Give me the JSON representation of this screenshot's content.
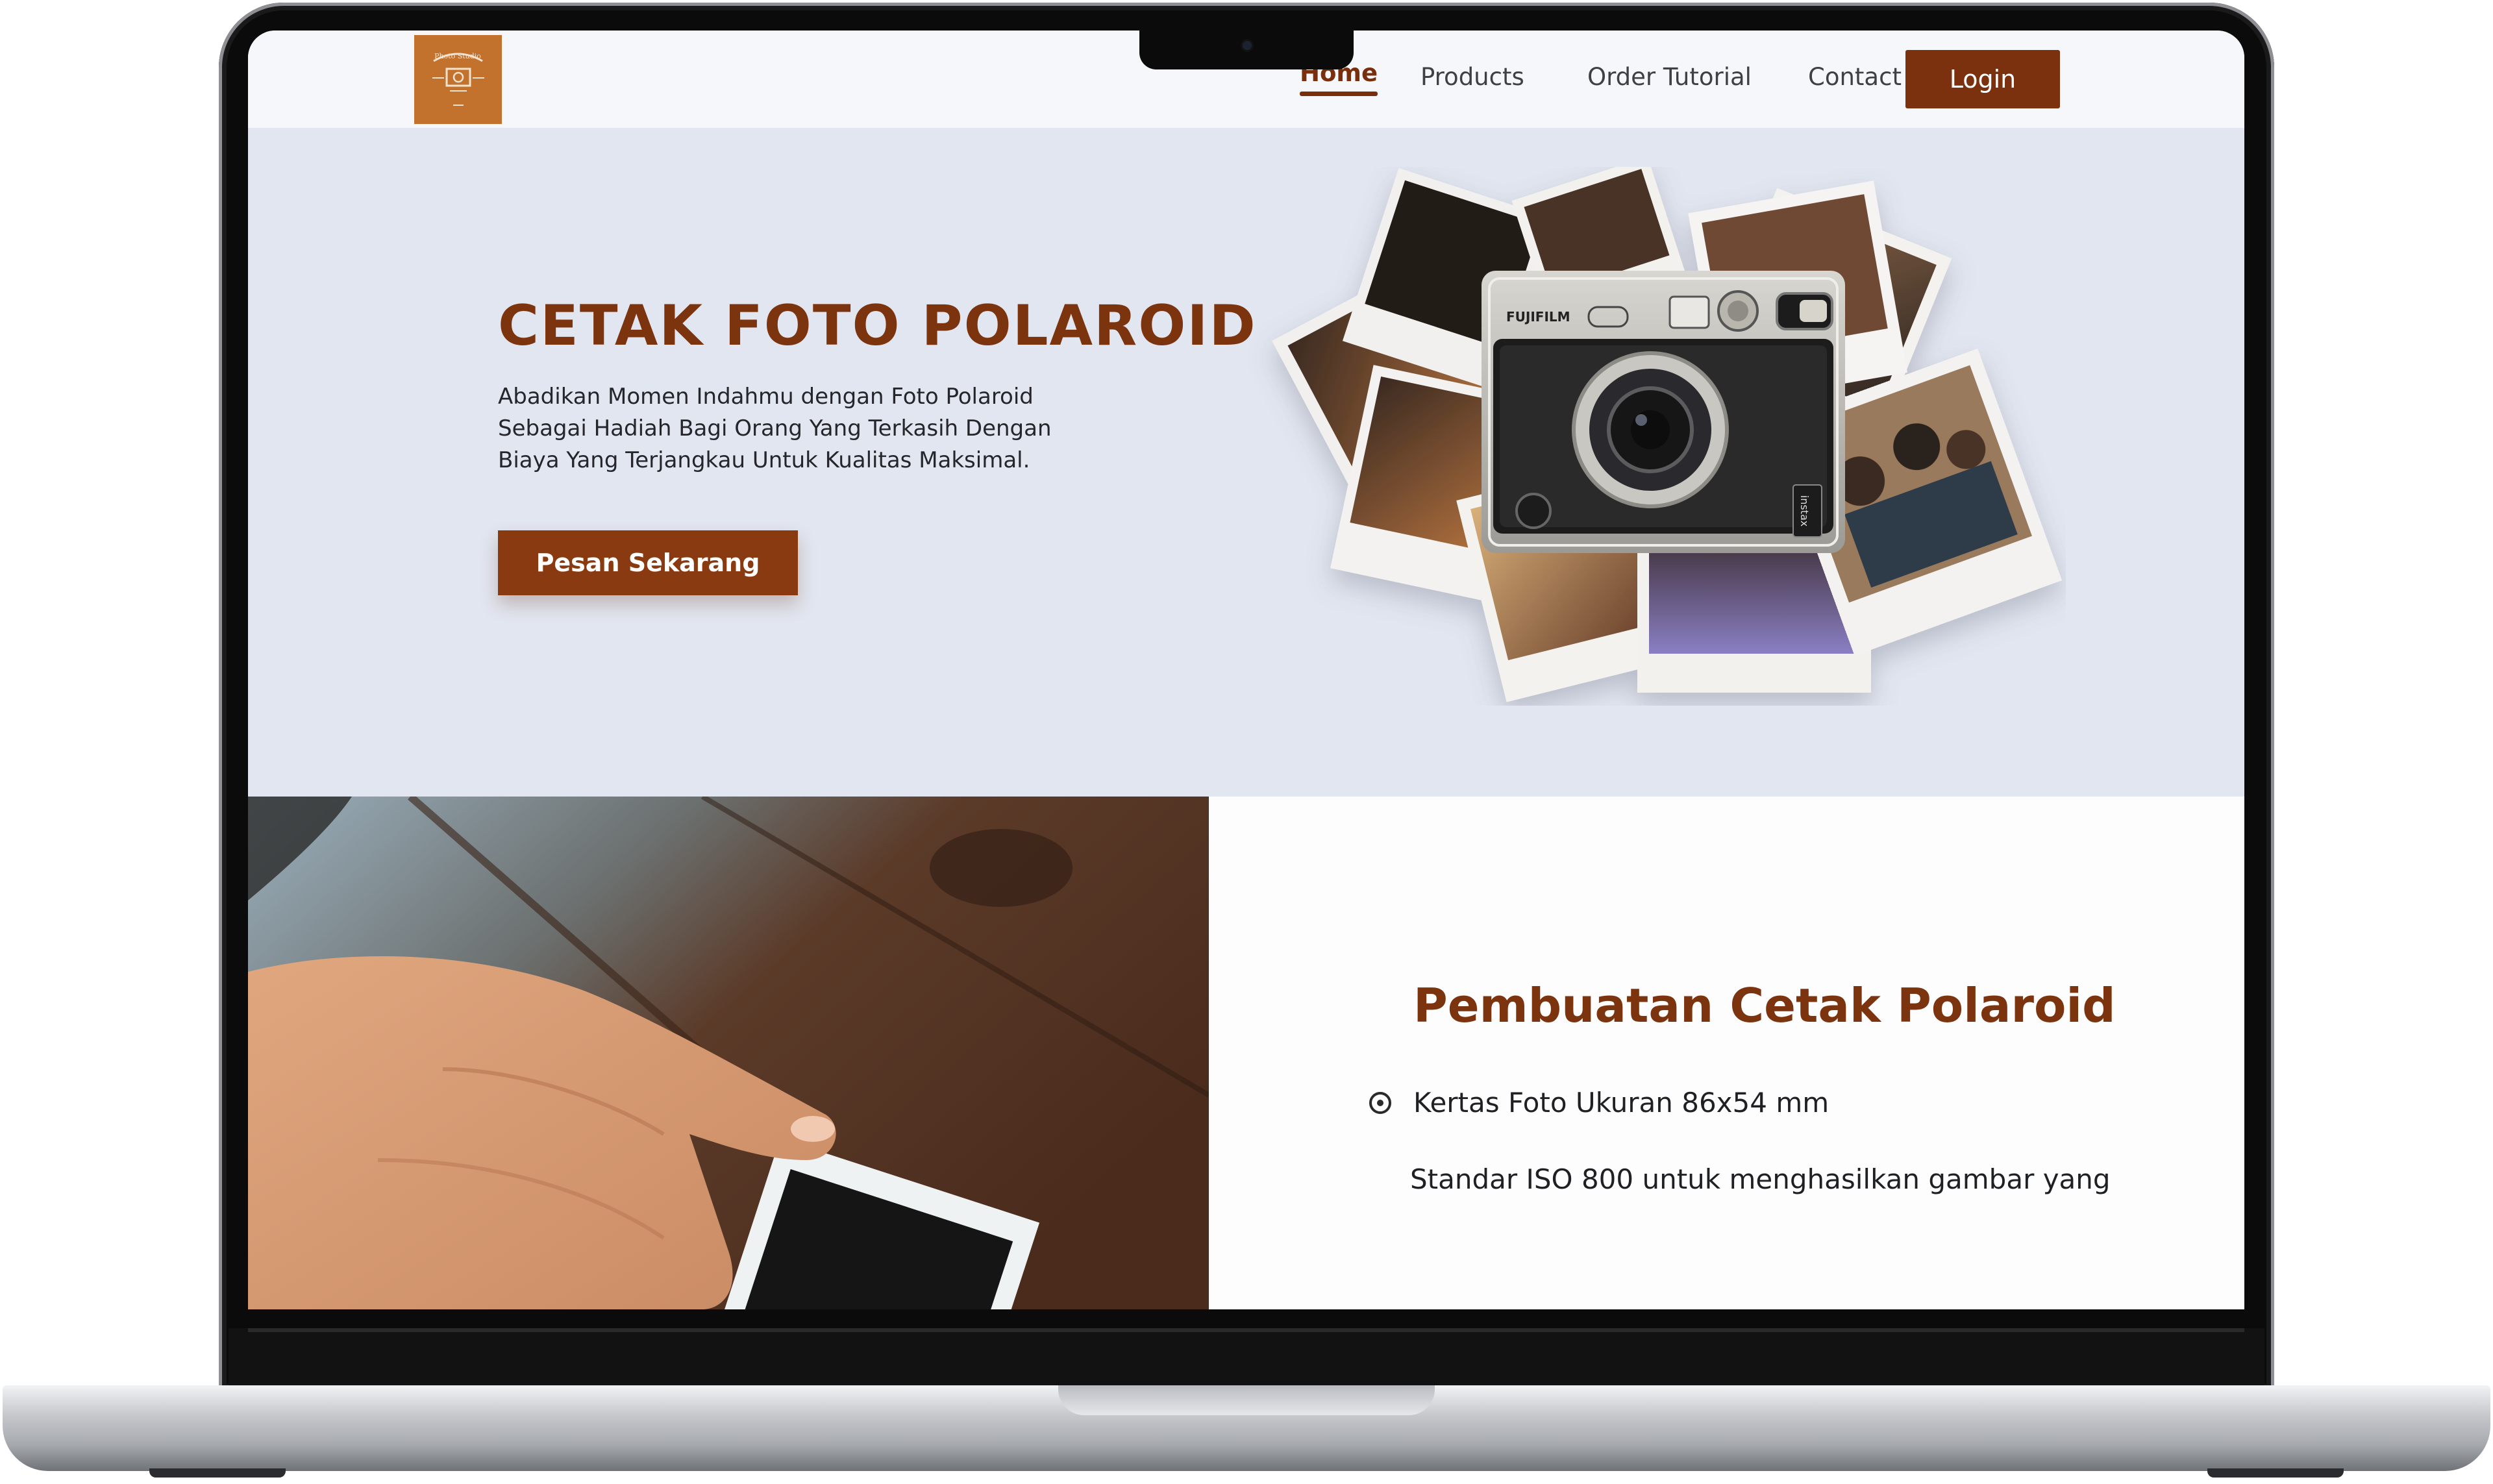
{
  "nav": {
    "logo_label": "Photo Studio",
    "links": [
      {
        "label": "Home",
        "active": true
      },
      {
        "label": "Products",
        "active": false
      },
      {
        "label": "Order Tutorial",
        "active": false
      },
      {
        "label": "Contact",
        "active": false
      }
    ],
    "login_label": "Login"
  },
  "hero": {
    "title": "CETAK FOTO POLAROID",
    "description": "Abadikan Momen Indahmu dengan Foto Polaroid Sebagai Hadiah Bagi Orang Yang Terkasih Dengan Biaya Yang Terjangkau Untuk Kualitas Maksimal.",
    "cta_label": "Pesan Sekarang",
    "camera_brand": "FUJIFILM",
    "camera_model": "instax"
  },
  "feature": {
    "title": "Pembuatan Cetak Polaroid",
    "bullet": "Kertas Foto Ukuran 86x54 mm",
    "description_partial": "Standar ISO 800 untuk menghasilkan gambar yang"
  },
  "colors": {
    "brand_brown": "#7c340f",
    "button_brown": "#8a3a11",
    "hero_bg": "#e2e6f0",
    "nav_bg": "#f6f7fb",
    "logo_bg": "#c3722e"
  }
}
